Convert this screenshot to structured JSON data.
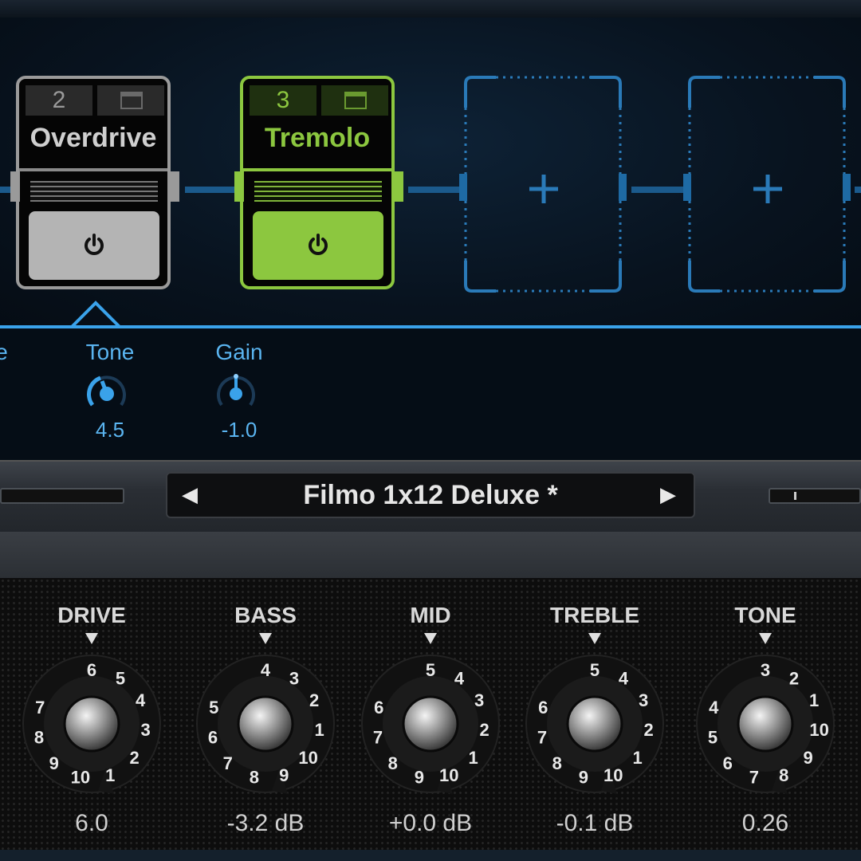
{
  "chain": {
    "pedals": [
      {
        "slot": "2",
        "name": "Overdrive",
        "state": "bypassed",
        "color": "#9a9a9a"
      },
      {
        "slot": "3",
        "name": "Tremolo",
        "state": "active",
        "color": "#8cc73f"
      }
    ],
    "empty_slot_icon": "plus-icon",
    "accent_color": "#3aa2ea"
  },
  "params": [
    {
      "label": "e",
      "value": ""
    },
    {
      "label": "Tone",
      "value": "4.5",
      "level": 0.45
    },
    {
      "label": "Gain",
      "value": "-1.0",
      "level": 0.45
    }
  ],
  "preset": {
    "name": "Filmo 1x12 Deluxe *",
    "prev_icon": "◀",
    "next_icon": "▶"
  },
  "amp": {
    "knobs": [
      {
        "label": "DRIVE",
        "value": "6.0",
        "scale": [
          "6",
          "5",
          "4",
          "3",
          "2",
          "1",
          "10",
          "9",
          "8",
          "7"
        ]
      },
      {
        "label": "BASS",
        "value": "-3.2 dB",
        "scale": [
          "4",
          "3",
          "2",
          "1",
          "10",
          "9",
          "8",
          "7",
          "6",
          "5"
        ]
      },
      {
        "label": "MID",
        "value": "+0.0 dB",
        "scale": [
          "5",
          "4",
          "3",
          "2",
          "1",
          "10",
          "9",
          "8",
          "7",
          "6"
        ]
      },
      {
        "label": "TREBLE",
        "value": "-0.1 dB",
        "scale": [
          "5",
          "4",
          "3",
          "2",
          "1",
          "10",
          "9",
          "8",
          "7",
          "6"
        ]
      },
      {
        "label": "TONE",
        "value": "0.26",
        "scale": [
          "3",
          "2",
          "1",
          "10",
          "9",
          "8",
          "7",
          "6",
          "5",
          "4"
        ]
      }
    ]
  }
}
